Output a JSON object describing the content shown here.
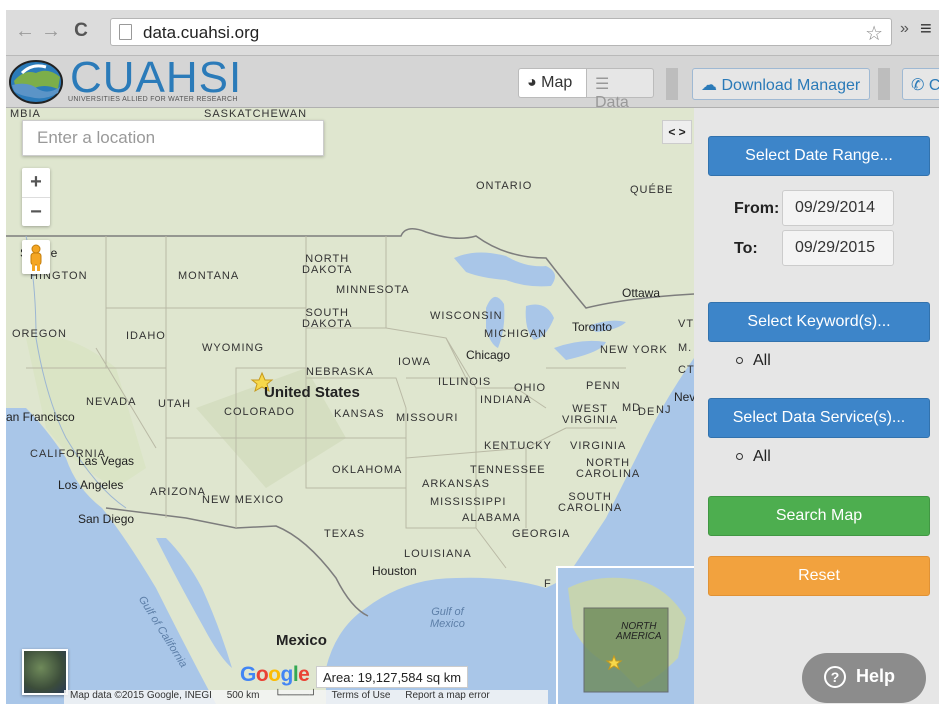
{
  "browser": {
    "url": "data.cuahsi.org",
    "back_glyph": "←",
    "forward_glyph": "→",
    "reload_glyph": "C",
    "ext_glyph": "»",
    "menu_glyph": "≡"
  },
  "header": {
    "logo_title": "CUAHSI",
    "logo_subtitle": "UNIVERSITIES ALLIED FOR WATER RESEARCH",
    "tab_map": "Map",
    "tab_data": "Data",
    "download_manager": "Download Manager",
    "contact": "Contact"
  },
  "map": {
    "search_placeholder": "Enter a location",
    "zoom_in": "+",
    "zoom_out": "−",
    "collapse_label": "< >",
    "regions": {
      "saskatchewan": "SASKATCHEWAN",
      "mbia": "MBIA",
      "ontario": "ONTARIO",
      "quebec": "QUÉBE",
      "washington": "HINGTON",
      "montana": "MONTANA",
      "north_dakota": "NORTH\nDAKOTA",
      "minnesota": "MINNESOTA",
      "oregon": "OREGON",
      "idaho": "IDAHO",
      "wyoming": "WYOMING",
      "south_dakota": "SOUTH\nDAKOTA",
      "wisconsin": "WISCONSIN",
      "michigan": "MICHIGAN",
      "iowa": "IOWA",
      "nebraska": "NEBRASKA",
      "illinois": "ILLINOIS",
      "ohio": "OHIO",
      "penn": "PENN",
      "nevada": "NEVADA",
      "utah": "UTAH",
      "colorado": "COLORADO",
      "kansas": "KANSAS",
      "missouri": "MISSOURI",
      "indiana": "INDIANA",
      "west_virginia": "WEST\nVIRGINIA",
      "md": "MD",
      "de": "DE",
      "nj": "NJ",
      "kentucky": "KENTUCKY",
      "virginia": "VIRGINIA",
      "california": "CALIFORNIA",
      "oklahoma": "OKLAHOMA",
      "tennessee": "TENNESSEE",
      "north_carolina": "NORTH\nCAROLINA",
      "arizona": "ARIZONA",
      "new_mexico": "NEW MEXICO",
      "arkansas": "ARKANSAS",
      "mississippi": "MISSISSIPPI",
      "alabama": "ALABAMA",
      "south_carolina": "SOUTH\nCAROLINA",
      "georgia": "GEORGIA",
      "texas": "TEXAS",
      "louisiana": "LOUISIANA",
      "new_york": "NEW YORK",
      "vt": "VT",
      "ma": "M.",
      "ct": "CT",
      "f": "F"
    },
    "cities": {
      "seattle": "Seattle",
      "ottawa": "Ottawa",
      "toronto": "Toronto",
      "chicago": "Chicago",
      "new_york": "Nev",
      "san_francisco": "an Francisco",
      "las_vegas": "Las Vegas",
      "los_angeles": "Los Angeles",
      "san_diego": "San Diego",
      "houston": "Houston"
    },
    "country_us": "United States",
    "country_mexico": "Mexico",
    "gulf_of_mexico": "Gulf of\nMexico",
    "gulf_of_california": "Gulf of California",
    "google_logo": "Google",
    "area_readout": "Area: 19,127,584 sq km",
    "footer": {
      "attribution": "Map data ©2015 Google, INEGI",
      "scale": "500 km",
      "terms": "Terms of Use",
      "report": "Report a map error"
    },
    "overview_label": "NORTH\nAMERICA"
  },
  "panel": {
    "select_date_range": "Select Date Range...",
    "from_label": "From:",
    "from_value": "09/29/2014",
    "to_label": "To:",
    "to_value": "09/29/2015",
    "select_keywords": "Select Keyword(s)...",
    "keywords_all": "All",
    "select_data_services": "Select Data Service(s)...",
    "services_all": "All",
    "search_map": "Search Map",
    "reset": "Reset",
    "help": "Help",
    "help_glyph": "?"
  },
  "colors": {
    "brand_blue": "#2b7bb9",
    "primary": "#3d85c9",
    "success": "#4dae4f",
    "warning": "#f2a23e",
    "help_gray": "#8c8c8c",
    "water": "#a9c6e8",
    "land": "#dfe6cf"
  }
}
